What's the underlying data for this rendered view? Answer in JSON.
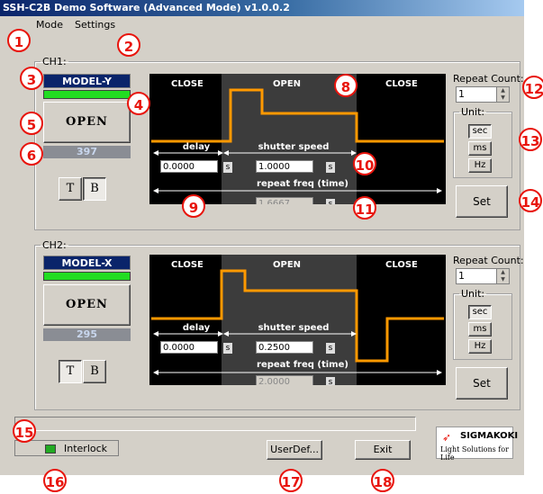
{
  "window": {
    "title": "SSH-C2B Demo Software (Advanced Mode) v1.0.0.2"
  },
  "menu": {
    "mode": "Mode",
    "settings": "Settings"
  },
  "channels": [
    {
      "legend": "CH1:",
      "model": "MODEL-Y",
      "open_label": "OPEN",
      "counter": "397",
      "t_label": "T",
      "b_label": "B",
      "selected_toggle": "B",
      "phases": {
        "close_left": "CLOSE",
        "open": "OPEN",
        "close_right": "CLOSE"
      },
      "labels": {
        "delay": "delay",
        "shutter": "shutter speed",
        "repeat": "repeat freq (time)"
      },
      "delay_value": "0.0000",
      "shutter_value": "1.0000",
      "repeat_value": "1.6667",
      "unit_s": "s",
      "repeat_count_label": "Repeat Count:",
      "repeat_count": "1",
      "unit_legend": "Unit:",
      "units": [
        "sec",
        "ms",
        "Hz"
      ],
      "selected_unit": "sec",
      "set_label": "Set"
    },
    {
      "legend": "CH2:",
      "model": "MODEL-X",
      "open_label": "OPEN",
      "counter": "295",
      "t_label": "T",
      "b_label": "B",
      "selected_toggle": "T",
      "phases": {
        "close_left": "CLOSE",
        "open": "OPEN",
        "close_right": "CLOSE"
      },
      "labels": {
        "delay": "delay",
        "shutter": "shutter speed",
        "repeat": "repeat freq (time)"
      },
      "delay_value": "0.0000",
      "shutter_value": "0.2500",
      "repeat_value": "2.0000",
      "unit_s": "s",
      "repeat_count_label": "Repeat Count:",
      "repeat_count": "1",
      "unit_legend": "Unit:",
      "units": [
        "sec",
        "ms",
        "Hz"
      ],
      "selected_unit": "sec",
      "set_label": "Set"
    }
  ],
  "footer": {
    "interlock": "Interlock",
    "userdef": "UserDef...",
    "exit": "Exit",
    "logo_name": "SIGMAKOKI",
    "logo_tagline": "Light Solutions for Life"
  },
  "markers": [
    "1",
    "2",
    "3",
    "4",
    "5",
    "6",
    "8",
    "9",
    "10",
    "11",
    "12",
    "13",
    "14",
    "15",
    "16",
    "17",
    "18"
  ],
  "colors": {
    "waveform": "#ff9900",
    "model_bg": "#0a246a",
    "led": "#22dd22",
    "marker": "#e8140c"
  }
}
